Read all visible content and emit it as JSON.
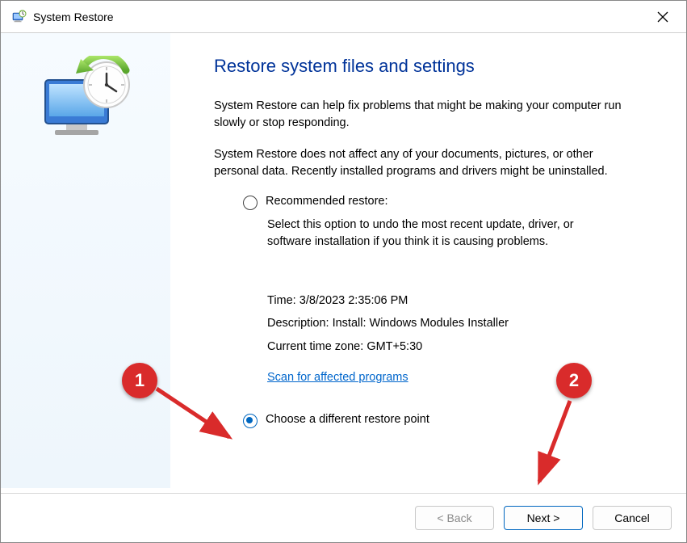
{
  "window": {
    "title": "System Restore"
  },
  "main": {
    "heading": "Restore system files and settings",
    "para1": "System Restore can help fix problems that might be making your computer run slowly or stop responding.",
    "para2": "System Restore does not affect any of your documents, pictures, or other personal data. Recently installed programs and drivers might be uninstalled.",
    "option1_label": "Recommended restore:",
    "option1_desc": "Select this option to undo the most recent update, driver, or software installation if you think it is causing problems.",
    "details": {
      "time_label": "Time:",
      "time_value": "3/8/2023 2:35:06 PM",
      "desc_label": "Description:",
      "desc_value": "Install: Windows Modules Installer",
      "tz_label": "Current time zone:",
      "tz_value": "GMT+5:30"
    },
    "scan_link": "Scan for affected programs",
    "option2_label": "Choose a different restore point"
  },
  "footer": {
    "back": "< Back",
    "next": "Next >",
    "cancel": "Cancel"
  },
  "annotations": {
    "one": "1",
    "two": "2"
  }
}
